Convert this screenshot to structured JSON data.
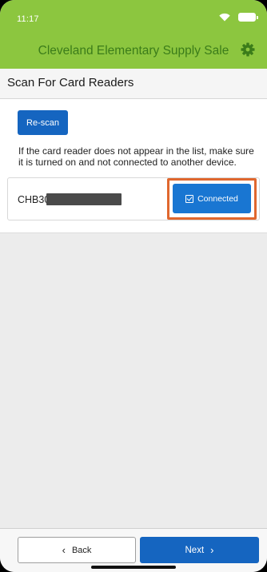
{
  "status_bar": {
    "time": "11:17",
    "icons": [
      "wifi-icon",
      "battery-icon"
    ]
  },
  "header": {
    "title": "Cleveland Elementary Supply Sale",
    "settings_icon": "gear-icon",
    "background_color": "#8cc63f",
    "title_color": "#3b7c1a"
  },
  "page": {
    "title": "Scan For Card Readers"
  },
  "scan": {
    "rescan_label": "Re-scan",
    "help_text": "If the card reader does not appear in the list, make sure it is turned on and not connected to another device."
  },
  "readers": [
    {
      "name": "CHB30",
      "status_label": "Connected",
      "status_icon": "checkbox-checked-icon",
      "highlight_color": "#e0672e"
    }
  ],
  "footer": {
    "back_label": "Back",
    "back_icon": "chevron-left-icon",
    "next_label": "Next",
    "next_icon": "chevron-right-icon",
    "primary_color": "#1565c0"
  }
}
